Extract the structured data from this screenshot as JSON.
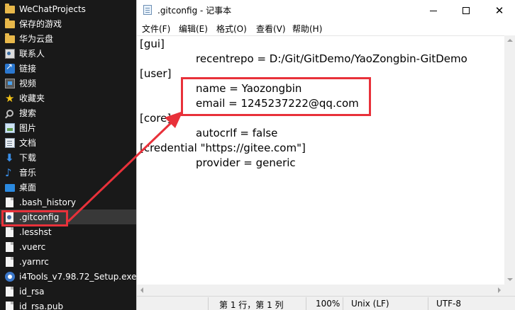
{
  "explorer": {
    "items": [
      {
        "label": "WeChatProjects",
        "icon": "folder-icon"
      },
      {
        "label": "保存的游戏",
        "icon": "folder-icon"
      },
      {
        "label": "华为云盘",
        "icon": "folder-icon"
      },
      {
        "label": "联系人",
        "icon": "contacts-icon"
      },
      {
        "label": "链接",
        "icon": "link-icon"
      },
      {
        "label": "视频",
        "icon": "video-icon"
      },
      {
        "label": "收藏夹",
        "icon": "star-icon"
      },
      {
        "label": "搜索",
        "icon": "search-icon"
      },
      {
        "label": "图片",
        "icon": "picture-icon"
      },
      {
        "label": "文档",
        "icon": "document-icon"
      },
      {
        "label": "下载",
        "icon": "download-icon"
      },
      {
        "label": "音乐",
        "icon": "music-icon"
      },
      {
        "label": "桌面",
        "icon": "desktop-icon"
      },
      {
        "label": ".bash_history",
        "icon": "file-icon"
      },
      {
        "label": ".gitconfig",
        "icon": "gitconfig-file-icon",
        "selected": true
      },
      {
        "label": ".lesshst",
        "icon": "file-icon"
      },
      {
        "label": ".vuerc",
        "icon": "file-icon"
      },
      {
        "label": ".yarnrc",
        "icon": "file-icon"
      },
      {
        "label": "i4Tools_v7.98.72_Setup.exe",
        "icon": "app-icon"
      },
      {
        "label": "id_rsa",
        "icon": "file-icon"
      },
      {
        "label": "id_rsa.pub",
        "icon": "file-icon"
      }
    ]
  },
  "notepad": {
    "title": ".gitconfig - 记事本",
    "menu": [
      "文件(F)",
      "编辑(E)",
      "格式(O)",
      "查看(V)",
      "帮助(H)"
    ],
    "lines": [
      {
        "text": "[gui]",
        "indent": false
      },
      {
        "text": "recentrepo = D:/Git/GitDemo/YaoZongbin-GitDemo",
        "indent": true
      },
      {
        "text": "[user]",
        "indent": false
      },
      {
        "text": "name = Yaozongbin",
        "indent": true
      },
      {
        "text": "email = 1245237222@qq.com",
        "indent": true
      },
      {
        "text": "[core]",
        "indent": false
      },
      {
        "text": "autocrlf = false",
        "indent": true
      },
      {
        "text": "[credential \"https://gitee.com\"]",
        "indent": false
      },
      {
        "text": "provider = generic",
        "indent": true
      }
    ],
    "status": {
      "position": "第 1 行，第 1 列",
      "zoom": "100%",
      "line_ending": "Unix (LF)",
      "encoding": "UTF-8"
    }
  },
  "annotation_color": "#e8313a"
}
